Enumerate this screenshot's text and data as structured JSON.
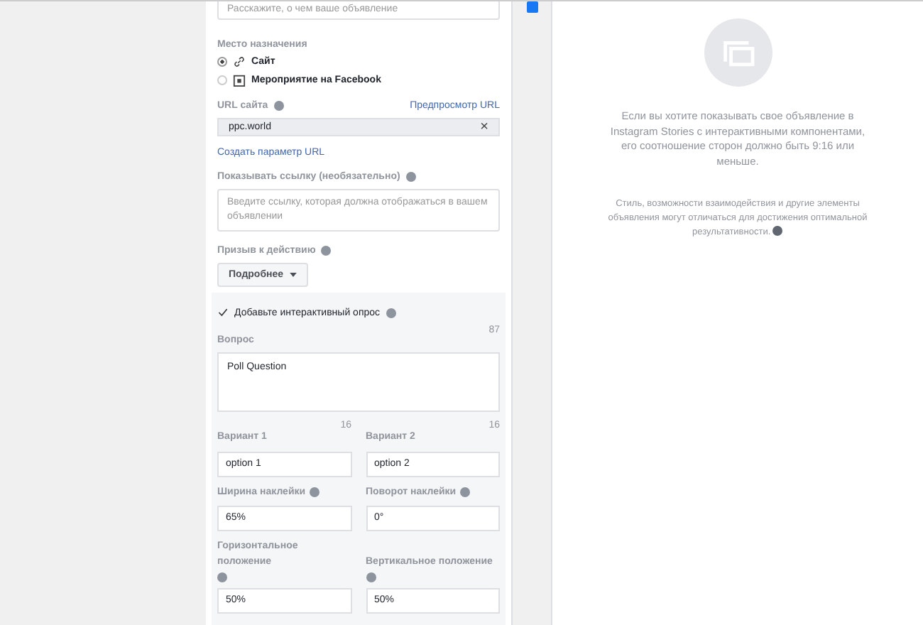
{
  "description_field": {
    "placeholder": "Расскажите, о чем ваше объявление"
  },
  "destination": {
    "label": "Место назначения",
    "options": [
      {
        "label": "Сайт",
        "selected": true,
        "kind": "link"
      },
      {
        "label": "Мероприятие на Facebook",
        "selected": false,
        "kind": "event"
      }
    ]
  },
  "url": {
    "label": "URL сайта",
    "preview_link": "Предпросмотр URL",
    "value": "ppc.world",
    "clear": "×"
  },
  "url_param_link": "Создать параметр URL",
  "display_link": {
    "label": "Показывать ссылку (необязательно)",
    "placeholder": "Введите ссылку, которая должна отображаться в вашем объявлении"
  },
  "cta": {
    "label": "Призыв к действию",
    "button": "Подробнее"
  },
  "poll": {
    "checked": true,
    "label": "Добавьте интерактивный опрос",
    "question_count": "87",
    "question_label": "Вопрос",
    "question": "Poll Question",
    "fields": [
      {
        "label": "Вариант 1",
        "count": "16",
        "value": "option 1",
        "info": false
      },
      {
        "label": "Вариант 2",
        "count": "16",
        "value": "option 2",
        "info": false
      },
      {
        "label": "Ширина наклейки",
        "value": "65%",
        "info": true
      },
      {
        "label": "Поворот наклейки",
        "value": "0°",
        "info": true
      },
      {
        "label": "Горизонтальное положение",
        "value": "50%",
        "info": true
      },
      {
        "label": "Вертикальное положение",
        "value": "50%",
        "info": true
      }
    ]
  },
  "preview": {
    "message": "Если вы хотите показывать свое объявление в Instagram Stories с интерактивными компонентами, его соотношение сторон должно быть 9:16 или меньше.",
    "note": "Стиль, возможности взаимодействия и другие элементы объявления могут отличаться для достижения оптимальной результативности."
  }
}
